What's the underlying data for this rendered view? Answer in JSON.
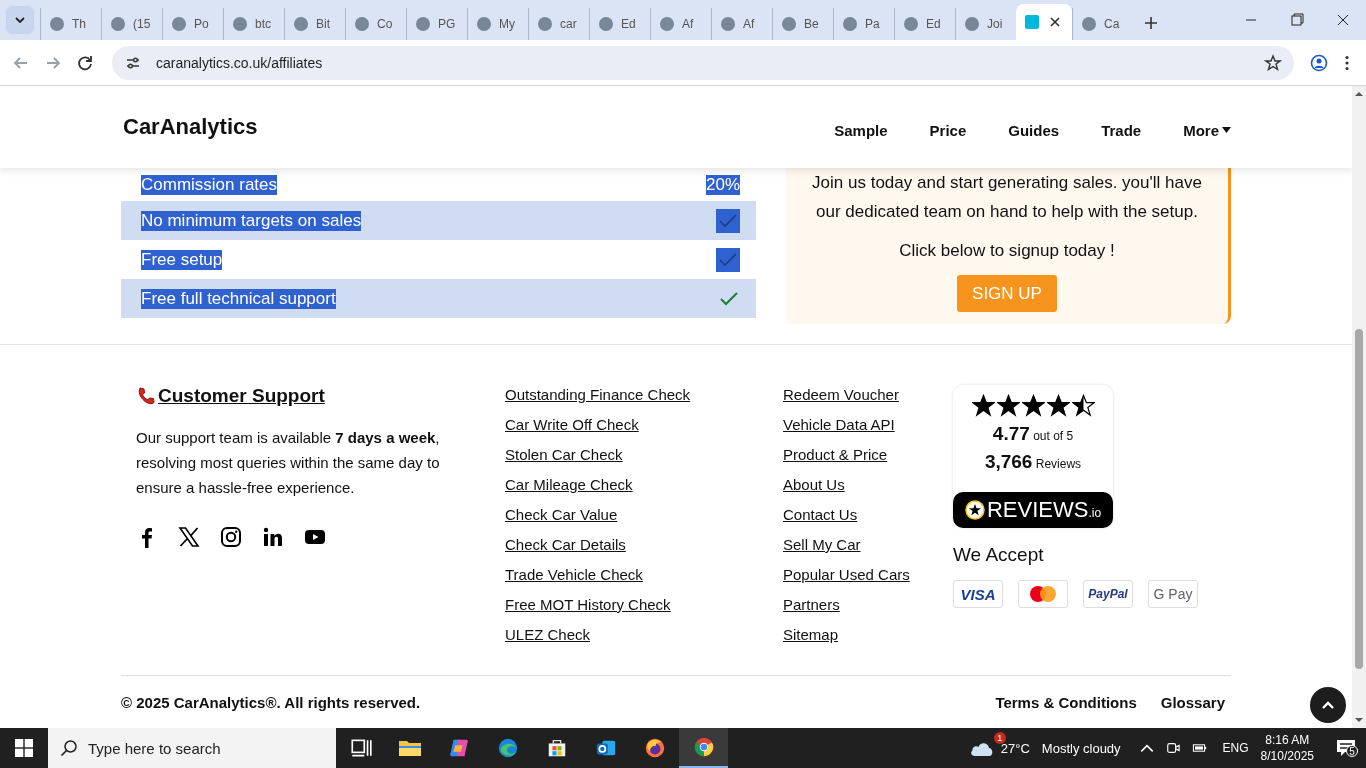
{
  "browser": {
    "tabs": [
      {
        "label": "Th",
        "selected": false
      },
      {
        "label": "(15",
        "selected": false
      },
      {
        "label": "Po",
        "selected": false
      },
      {
        "label": "btc",
        "selected": false
      },
      {
        "label": "Bit",
        "selected": false
      },
      {
        "label": "Co",
        "selected": false
      },
      {
        "label": "PG",
        "selected": false
      },
      {
        "label": "My",
        "selected": false
      },
      {
        "label": "car",
        "selected": false
      },
      {
        "label": "Ed",
        "selected": false
      },
      {
        "label": "Af",
        "selected": false
      },
      {
        "label": "Af",
        "selected": false
      },
      {
        "label": "Be",
        "selected": false
      },
      {
        "label": "Pa",
        "selected": false
      },
      {
        "label": "Ed",
        "selected": false
      },
      {
        "label": "Joi",
        "selected": false
      },
      {
        "selected": true
      },
      {
        "label": "Ca",
        "selected": false
      }
    ],
    "address": "caranalytics.co.uk/affiliates"
  },
  "header": {
    "logo": "CarAnalytics",
    "nav": [
      {
        "label": "Sample",
        "dropdown": false
      },
      {
        "label": "Price",
        "dropdown": false
      },
      {
        "label": "Guides",
        "dropdown": false
      },
      {
        "label": "Trade",
        "dropdown": false
      },
      {
        "label": "More",
        "dropdown": true
      }
    ]
  },
  "features": {
    "text_selected": true,
    "rows": [
      {
        "label": "Commission rates",
        "kind": "value",
        "value": "20%"
      },
      {
        "label": "No minimum targets on sales",
        "kind": "checkbox",
        "checked": true
      },
      {
        "label": "Free setup",
        "kind": "checkbox",
        "checked": true
      },
      {
        "label": "Free full technical support",
        "kind": "tick"
      }
    ]
  },
  "signup": {
    "text": "Join us today and start generating sales. you'll have our dedicated team on hand to help with the setup.",
    "prompt": "Click below to signup today !",
    "button": "SIGN UP"
  },
  "footer": {
    "support": {
      "heading": "Customer Support",
      "text": "Our support team is available **7 days a week**, resolving most queries within the same day to ensure a hassle-free experience."
    },
    "links_1": [
      "Outstanding Finance Check",
      "Car Write Off Check",
      "Stolen Car Check",
      "Car Mileage Check",
      "Check Car Value",
      "Check Car Details",
      "Trade Vehicle Check",
      "Free MOT History Check",
      "ULEZ Check"
    ],
    "links_2": [
      "Redeem Voucher",
      "Vehicle Data API",
      "Product & Price",
      "About Us",
      "Contact Us",
      "Sell My Car",
      "Popular Used Cars",
      "Partners",
      "Sitemap"
    ],
    "reviews": {
      "stars": 4.5,
      "rating": "4.77",
      "rating_suffix": "out of 5",
      "count": "3,766",
      "count_suffix": "Reviews",
      "brand": "REVIEWS",
      "brand_suffix": ".io"
    },
    "payments": {
      "heading": "We Accept",
      "methods": [
        {
          "kind": "visa",
          "label": "VISA"
        },
        {
          "kind": "mastercard"
        },
        {
          "kind": "paypal",
          "label": "PayPal"
        },
        {
          "kind": "gpay",
          "label": "G Pay"
        }
      ]
    }
  },
  "bottom": {
    "copyright": "© 2025 CarAnalytics®. All rights reserved.",
    "links": [
      "Terms & Conditions",
      "Glossary"
    ]
  },
  "taskbar": {
    "search_placeholder": "Type here to search",
    "apps": [
      {
        "kind": "taskview",
        "selected": false
      },
      {
        "kind": "explorer",
        "selected": false
      },
      {
        "kind": "copilot",
        "selected": false
      },
      {
        "kind": "edge",
        "selected": false
      },
      {
        "kind": "store",
        "selected": false
      },
      {
        "kind": "outlook",
        "selected": false
      },
      {
        "kind": "firefox",
        "selected": false
      },
      {
        "kind": "chrome",
        "selected": true
      }
    ],
    "weather": {
      "badge": "1",
      "temperature": "27°C",
      "condition": "Mostly cloudy"
    },
    "language": "ENG",
    "time": "8:16 AM",
    "date": "8/10/2025",
    "notifications": "5"
  }
}
